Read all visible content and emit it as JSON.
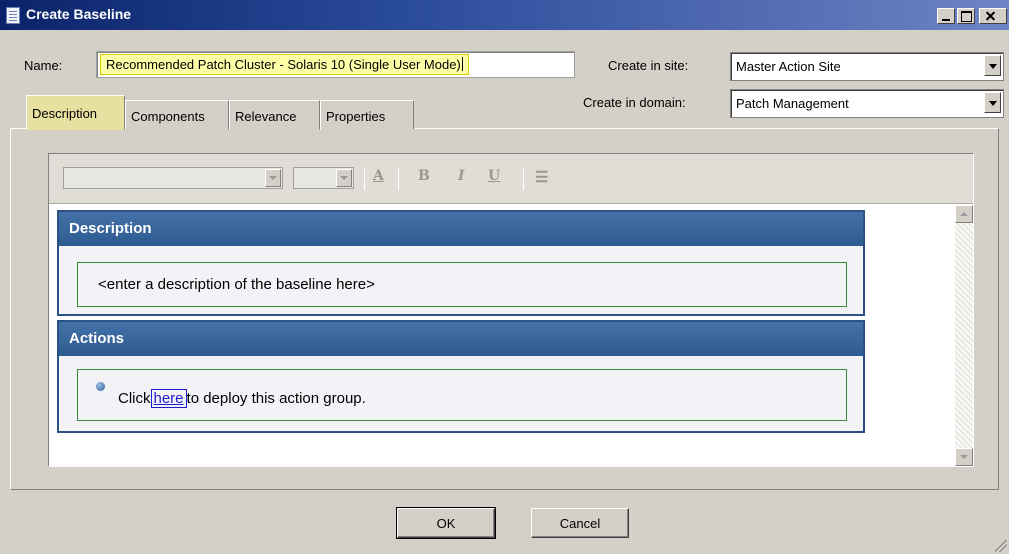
{
  "window": {
    "title": "Create Baseline"
  },
  "form": {
    "name_label": "Name:",
    "name_value": "Recommended Patch Cluster - Solaris 10 (Single User Mode)",
    "site_label": "Create in site:",
    "site_value": "Master Action Site",
    "domain_label": "Create in domain:",
    "domain_value": "Patch Management"
  },
  "tabs": [
    {
      "label": "Description",
      "active": true
    },
    {
      "label": "Components",
      "active": false
    },
    {
      "label": "Relevance",
      "active": false
    },
    {
      "label": "Properties",
      "active": false
    }
  ],
  "toolbar": {
    "font_color_icon": "font-color-icon",
    "bold_icon": "bold-icon",
    "italic_icon": "italic-icon",
    "underline_icon": "underline-icon",
    "list_icon": "numbered-list-icon"
  },
  "content": {
    "description_heading": "Description",
    "description_text": "<enter a description of the baseline here>",
    "actions_heading": "Actions",
    "action_prefix": "Click",
    "action_link": "here",
    "action_suffix": "to deploy this action group."
  },
  "buttons": {
    "ok": "OK",
    "cancel": "Cancel"
  },
  "colors": {
    "title_bar": "#0a246a",
    "section_header": "#2e5a92",
    "active_tab": "#e8e0a0",
    "name_highlight": "#ffffa8",
    "link": "#1c1cc8"
  }
}
